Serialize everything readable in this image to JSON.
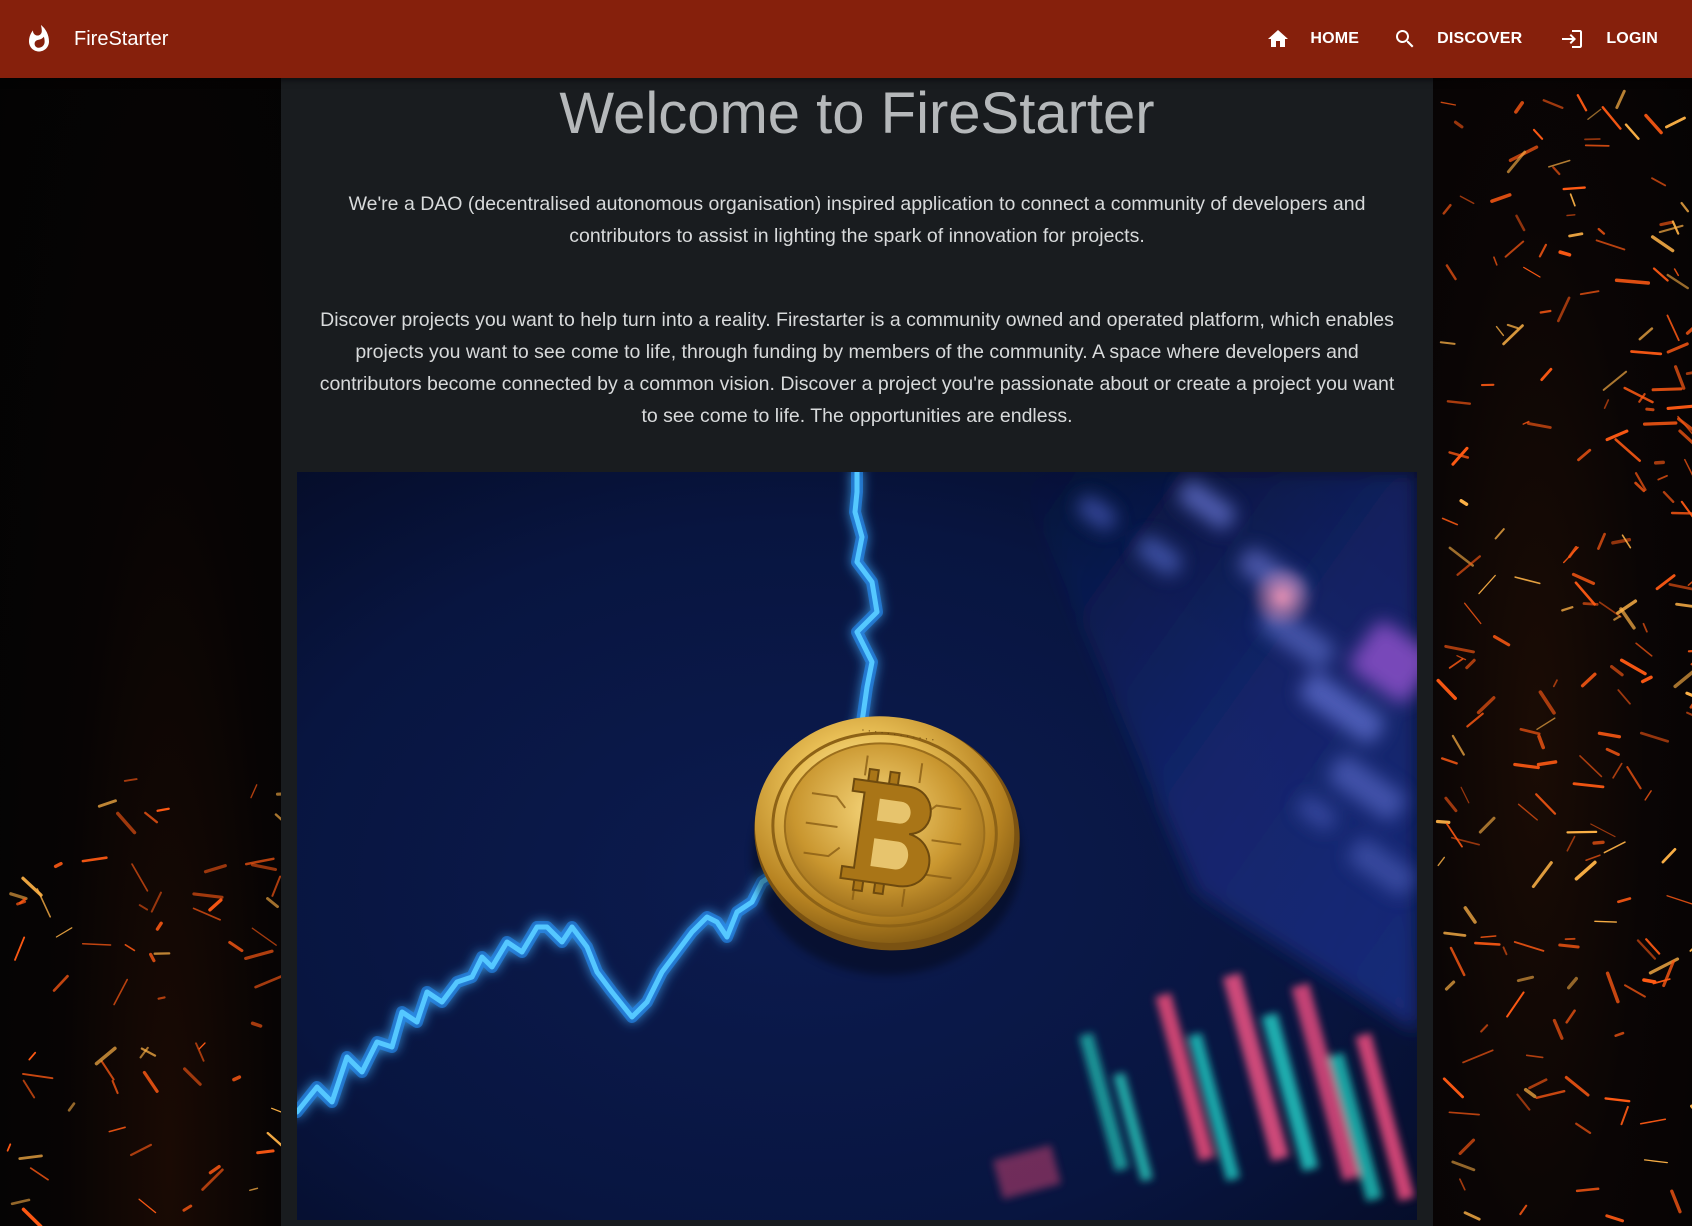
{
  "brand": {
    "name": "FireStarter",
    "logo_icon": "flame-icon"
  },
  "nav": {
    "items": [
      {
        "label": "HOME",
        "icon": "home-icon"
      },
      {
        "label": "DISCOVER",
        "icon": "search-icon"
      },
      {
        "label": "LOGIN",
        "icon": "login-icon"
      }
    ]
  },
  "main": {
    "title": "Welcome to FireStarter",
    "intro": "We're a DAO (decentralised autonomous organisation) inspired application to connect a community of developers and contributors to assist in lighting the spark of innovation for projects.",
    "discover": "Discover projects you want to help turn into a reality. Firestarter is a community owned and operated platform, which enables projects you want to see come to life, through funding by members of the community. A space where developers and contributors become connected by a common vision. Discover a project you're passionate about or create a project you want to see come to life. The opportunities are endless."
  },
  "colors": {
    "topbar": "#86200c",
    "panel": "#191c1f",
    "spark": "#ff5a14"
  }
}
